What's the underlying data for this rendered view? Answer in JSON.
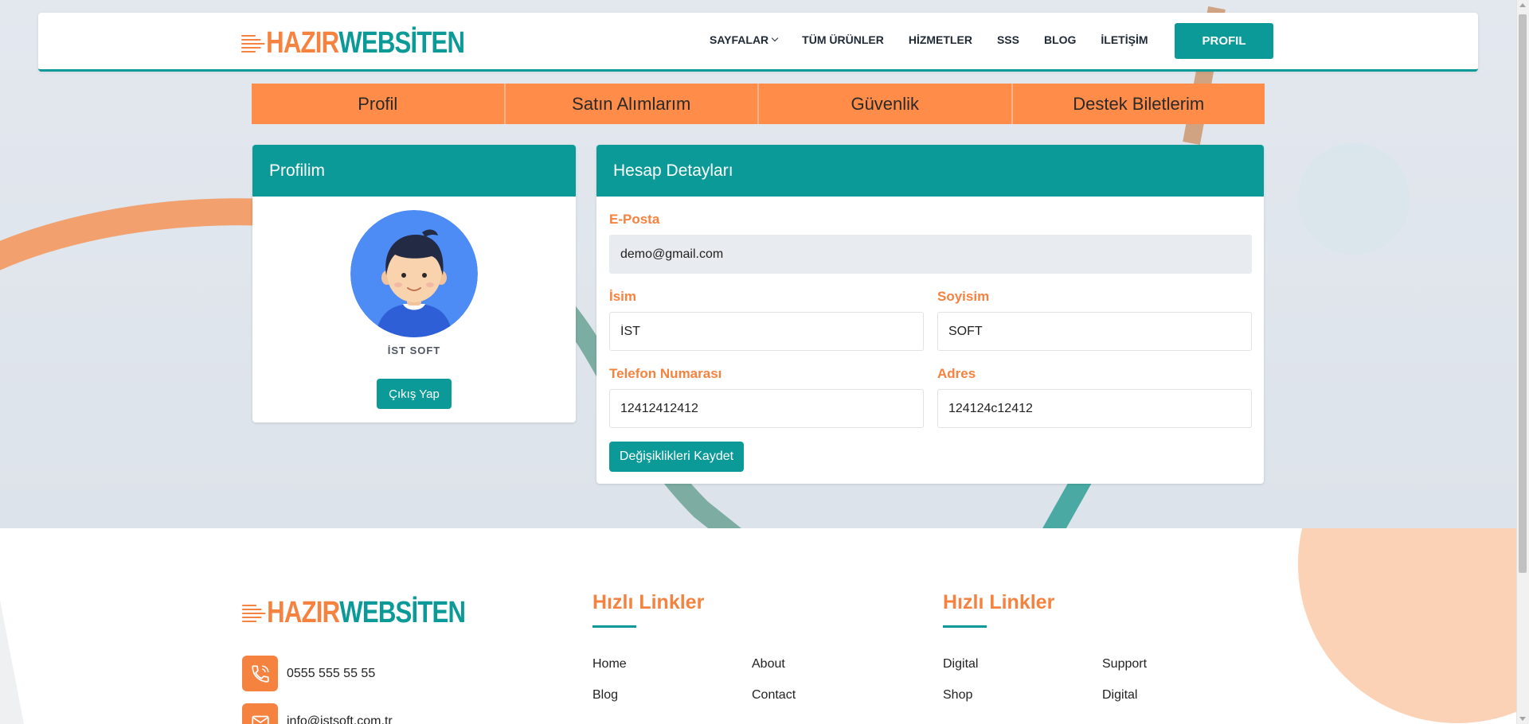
{
  "brand": {
    "part1": "HAZIR",
    "part2": "WEBSİTEN"
  },
  "nav": {
    "items": [
      {
        "label": "SAYFALAR",
        "dropdown": true
      },
      {
        "label": "TÜM ÜRÜNLER"
      },
      {
        "label": "HİZMETLER"
      },
      {
        "label": "SSS"
      },
      {
        "label": "BLOG"
      },
      {
        "label": "İLETİŞİM"
      }
    ],
    "profile_button": "PROFIL"
  },
  "tabs": [
    "Profil",
    "Satın Alımlarım",
    "Güvenlik",
    "Destek Biletlerim"
  ],
  "profile_card": {
    "title": "Profilim",
    "user_name": "İST SOFT",
    "logout_label": "Çıkış Yap"
  },
  "account_card": {
    "title": "Hesap Detayları",
    "email": {
      "label": "E-Posta",
      "value": "demo@gmail.com"
    },
    "first_name": {
      "label": "İsim",
      "value": "İST"
    },
    "last_name": {
      "label": "Soyisim",
      "value": "SOFT"
    },
    "phone": {
      "label": "Telefon Numarası",
      "value": "12412412412"
    },
    "address": {
      "label": "Adres",
      "value": "124124c12412"
    },
    "save_label": "Değişiklikleri Kaydet"
  },
  "footer": {
    "phone": "0555 555 55 55",
    "email": "info@istsoft.com.tr",
    "col1": {
      "title": "Hızlı Linkler",
      "links": [
        "Home",
        "About",
        "Blog",
        "Contact"
      ]
    },
    "col2": {
      "title": "Hızlı Linkler",
      "links": [
        "Digital",
        "Support",
        "Shop",
        "Digital"
      ]
    }
  },
  "colors": {
    "accent_teal": "#0b9a97",
    "accent_orange": "#f5823f",
    "tab_orange": "#ff8c48"
  },
  "icons": [
    "chevron-down-icon",
    "avatar-illustration",
    "phone-icon",
    "mail-icon",
    "speed-lines-icon"
  ]
}
